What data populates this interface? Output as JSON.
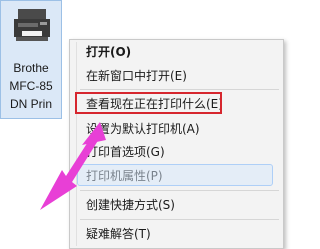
{
  "printer": {
    "label_lines": [
      "Brothe",
      "MFC-85",
      "DN Prin"
    ]
  },
  "menu": {
    "items": [
      {
        "label": "打开(O)",
        "bold": true
      },
      {
        "label": "在新窗口中打开(E)"
      },
      {
        "label": "查看现在正在打印什么(E)",
        "annotated": true
      },
      {
        "label": "设置为默认打印机(A)"
      },
      {
        "label": "打印首选项(G)"
      },
      {
        "label": "打印机属性(P)",
        "hovered": true
      },
      {
        "label": "创建快捷方式(S)"
      },
      {
        "label": "疑难解答(T)"
      }
    ]
  },
  "colors": {
    "annotation_box": "#d6262e",
    "arrow": "#e83fd6",
    "tile_bg": "#dbe8f7"
  }
}
